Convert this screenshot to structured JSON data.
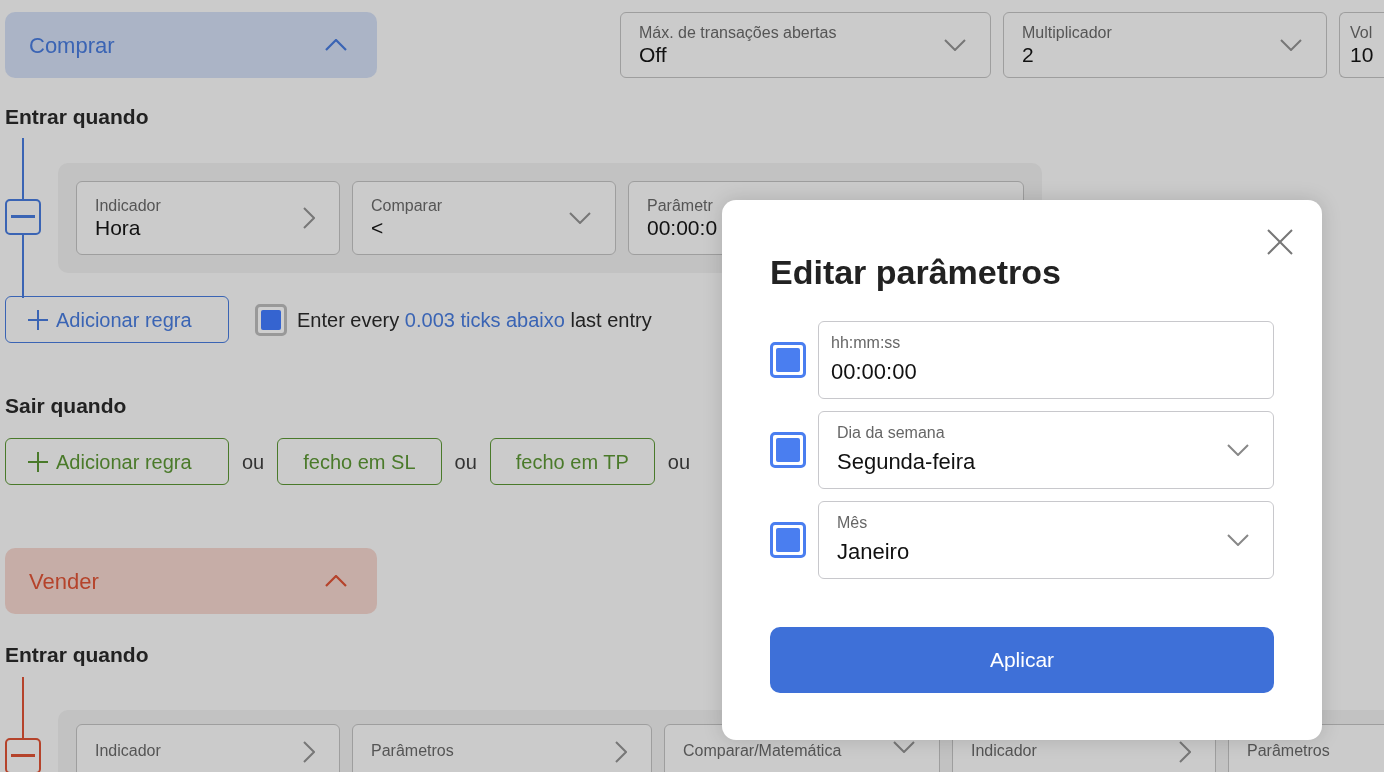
{
  "settings_selects": [
    {
      "label": "Máx. de transações abertas",
      "value": "Off",
      "kind": "dropdown"
    },
    {
      "label": "Multiplicador",
      "value": "2",
      "kind": "dropdown"
    },
    {
      "label": "Vol",
      "value": "10",
      "kind": "cut"
    }
  ],
  "sections": [
    {
      "title": "Comprar",
      "color": "#3a64b4",
      "expanded": true,
      "entry_label": "Entrar quando",
      "rule_fields": [
        {
          "label": "Indicador",
          "value": "Hora",
          "kind": "link"
        },
        {
          "label": "Comparar",
          "value": "<",
          "kind": "dropdown"
        },
        {
          "label": "Parâmetr",
          "value": "00:00:0",
          "kind": "cut"
        }
      ],
      "add_rule": "Adicionar regra",
      "repeat_entry": {
        "checked": true,
        "prefix": "Enter every",
        "link": "0.003 ticks abaixo",
        "suffix": "last entry"
      },
      "exit_label": "Sair quando",
      "exit_items": [
        {
          "kind": "add",
          "text": "Adicionar regra"
        },
        {
          "kind": "separator",
          "text": "ou"
        },
        {
          "kind": "button",
          "text": "fecho em SL"
        },
        {
          "kind": "separator",
          "text": "ou"
        },
        {
          "kind": "button",
          "text": "fecho em TP"
        },
        {
          "kind": "separator",
          "text": "ou"
        }
      ]
    },
    {
      "title": "Vender",
      "color": "#b5432b",
      "expanded": true,
      "entry_label": "Entrar quando",
      "rule_fields": [
        {
          "label": "Indicador",
          "kind": "link"
        },
        {
          "label": "Parâmetros",
          "kind": "link"
        },
        {
          "label": "Comparar/Matemática",
          "kind": "dropdown"
        },
        {
          "label": "Indicador",
          "kind": "link"
        },
        {
          "label": "Parâmetros",
          "kind": "cut"
        }
      ]
    }
  ],
  "dialog": {
    "title": "Editar parâmetros",
    "rows": [
      {
        "checked": true,
        "kind": "text",
        "label": "hh:mm:ss",
        "value": "00:00:00"
      },
      {
        "checked": true,
        "kind": "dropdown",
        "label": "Dia da semana",
        "value": "Segunda-feira"
      },
      {
        "checked": true,
        "kind": "dropdown",
        "label": "Mês",
        "value": "Janeiro"
      }
    ],
    "apply": "Aplicar"
  }
}
